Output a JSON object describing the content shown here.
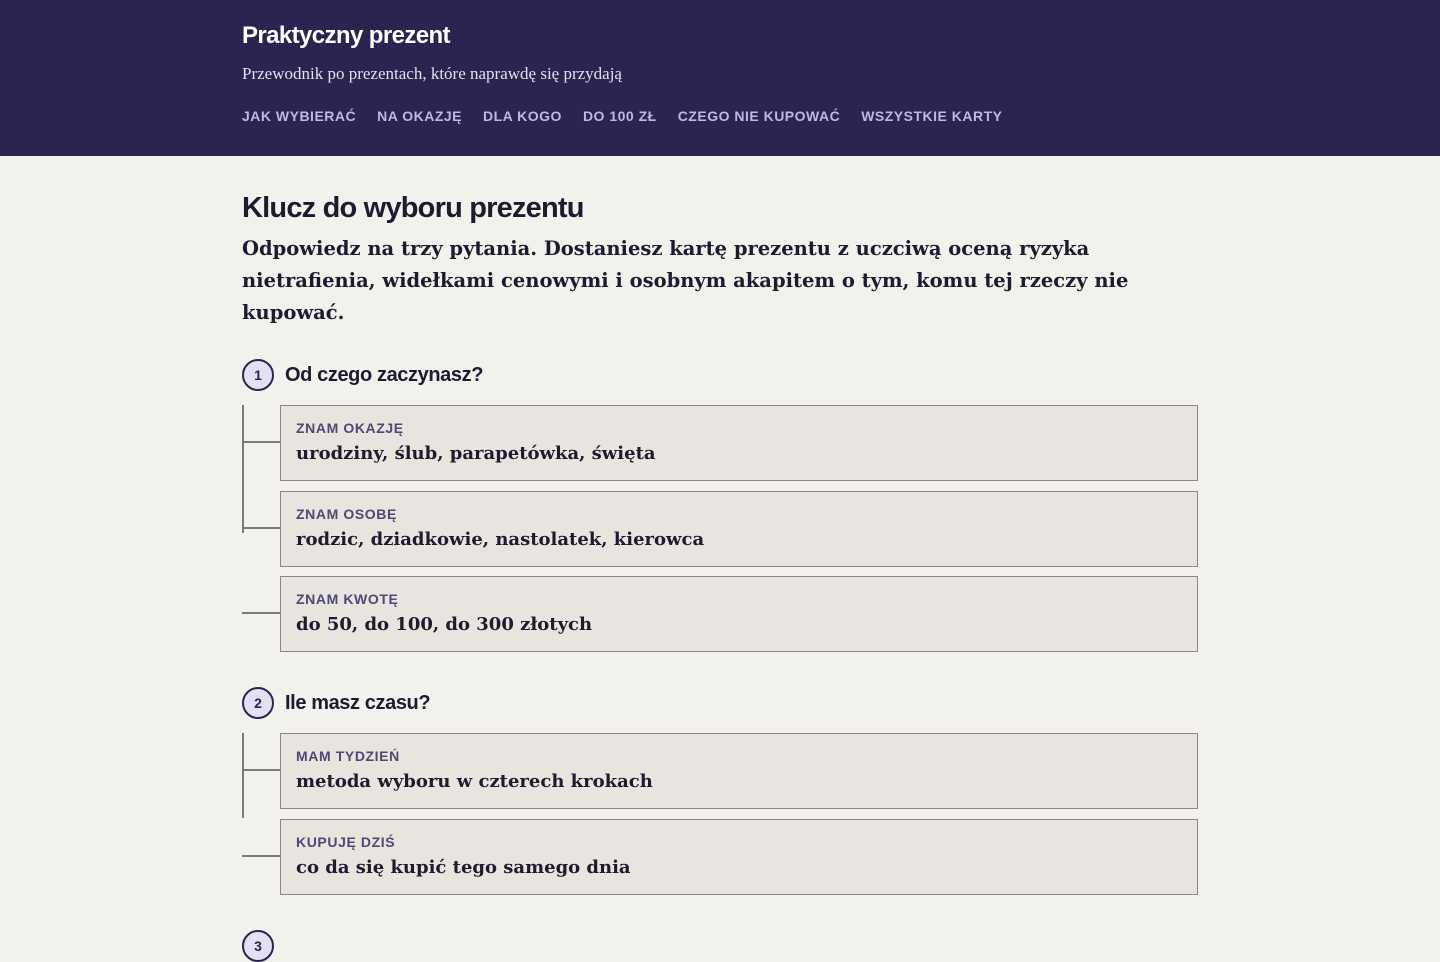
{
  "header": {
    "brand": "Praktyczny prezent",
    "tagline": "Przewodnik po prezentach, które naprawdę się przydają",
    "nav": [
      "JAK WYBIERAĆ",
      "NA OKAZJĘ",
      "DLA KOGO",
      "DO 100 ZŁ",
      "CZEGO NIE KUPOWAĆ",
      "WSZYSTKIE KARTY"
    ]
  },
  "main": {
    "title": "Klucz do wyboru prezentu",
    "lead": "Odpowiedz na trzy pytania. Dostaniesz kartę prezentu z uczciwą oceną ryzyka nietrafienia, widełkami cenowymi i osobnym akapitem o tym, komu tej rzeczy nie kupować.",
    "steps": [
      {
        "number": "1",
        "question": "Od czego zaczynasz?",
        "options": [
          {
            "label": "ZNAM OKAZJĘ",
            "text": "urodziny, ślub, parapetówka, święta"
          },
          {
            "label": "ZNAM OSOBĘ",
            "text": "rodzic, dziadkowie, nastolatek, kierowca"
          },
          {
            "label": "ZNAM KWOTĘ",
            "text": "do 50, do 100, do 300 złotych"
          }
        ]
      },
      {
        "number": "2",
        "question": "Ile masz czasu?",
        "options": [
          {
            "label": "MAM TYDZIEŃ",
            "text": "metoda wyboru w czterech krokach"
          },
          {
            "label": "KUPUJĘ DZIŚ",
            "text": "co da się kupić tego samego dnia"
          }
        ]
      },
      {
        "number": "3"
      }
    ]
  },
  "colors": {
    "header_bg": "#2b2350",
    "page_bg": "#f2f1ec",
    "nav_link": "#bfb6ec",
    "card_bg": "#e7e5de",
    "card_label": "#4d4876"
  }
}
